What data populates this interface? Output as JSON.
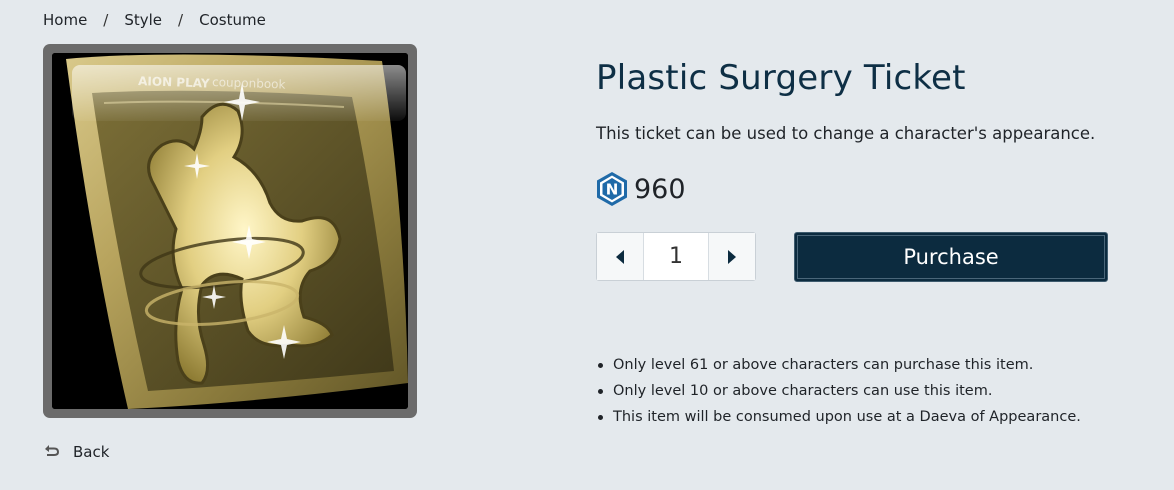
{
  "breadcrumb": {
    "items": [
      "Home",
      "Style",
      "Costume"
    ],
    "separator": "/"
  },
  "product": {
    "image_alt": "plastic-surgery-ticket-image",
    "image_watermark": "AION PLAY couponbook",
    "title": "Plastic Surgery Ticket",
    "description": "This ticket can be used to change a character's appearance.",
    "currency_icon": "ncoin-icon",
    "currency_letter": "N",
    "price": "960"
  },
  "stepper": {
    "decrement_icon": "caret-left-icon",
    "value": "1",
    "increment_icon": "caret-right-icon"
  },
  "purchase_label": "Purchase",
  "notes": [
    "Only level 61 or above characters can purchase this item.",
    "Only level 10 or above characters can use this item.",
    "This item will be consumed upon use at a Daeva of Appearance."
  ],
  "back": {
    "icon": "undo-arrow-icon",
    "label": "Back"
  },
  "colors": {
    "background": "#e4e9ed",
    "title": "#0e2f45",
    "purchase_bg": "#0c2b3f",
    "coin": "#1f6aa8"
  }
}
